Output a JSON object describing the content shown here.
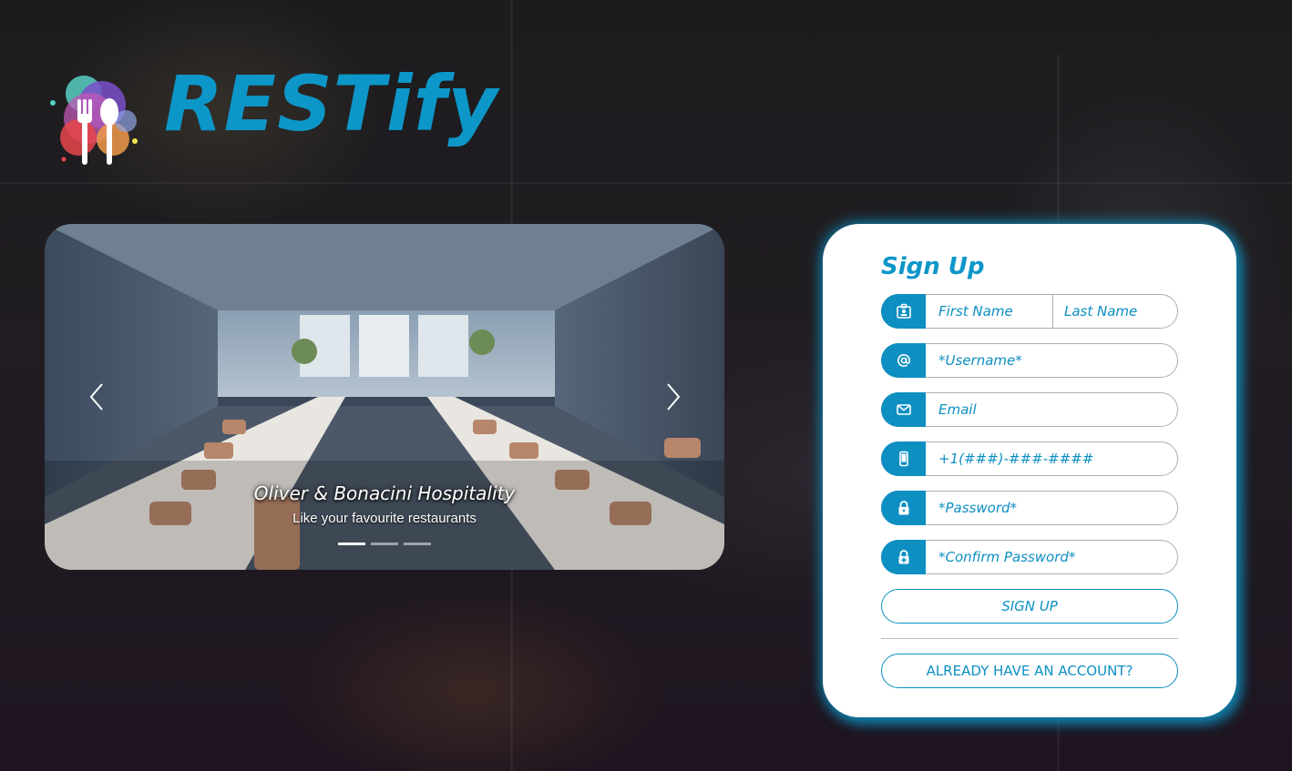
{
  "brand": {
    "name": "RESTify"
  },
  "carousel": {
    "caption_title": "Oliver & Bonacini Hospitality",
    "caption_subtitle": "Like your favourite restaurants",
    "slides_total": 3,
    "active_slide": 1
  },
  "signup": {
    "title": "Sign Up",
    "fields": {
      "first_name_placeholder": "First Name",
      "last_name_placeholder": "Last Name",
      "username_placeholder": "*Username*",
      "email_placeholder": "Email",
      "phone_placeholder": "+1(###)-###-####",
      "password_placeholder": "*Password*",
      "confirm_password_placeholder": "*Confirm Password*"
    },
    "signup_button": "SIGN UP",
    "login_button": "ALREADY HAVE AN ACCOUNT?"
  },
  "colors": {
    "accent": "#0d96c8",
    "card_bg": "#ffffff"
  },
  "icons": [
    "id-card-icon",
    "at-sign-icon",
    "envelope-icon",
    "phone-icon",
    "lock-icon",
    "lock-plus-icon",
    "chevron-left-icon",
    "chevron-right-icon",
    "restaurant-logo"
  ]
}
